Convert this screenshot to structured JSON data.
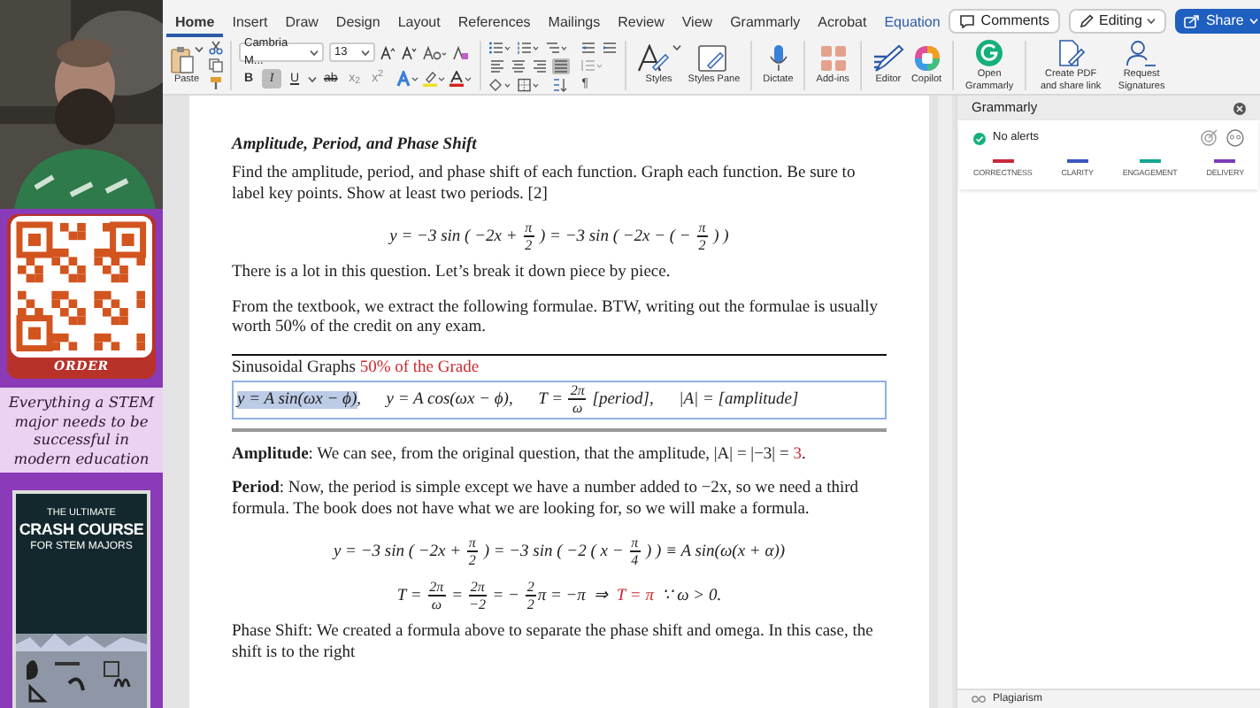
{
  "promo": {
    "button": "ORDER",
    "tagline": "Everything a STEM major needs to be successful in modern education",
    "book": {
      "overline": "THE ULTIMATE",
      "title": "CRASH COURSE",
      "subtitle": "FOR STEM MAJORS"
    }
  },
  "tabs": [
    {
      "label": "Home",
      "selected": true,
      "contextual": false
    },
    {
      "label": "Insert",
      "selected": false,
      "contextual": false
    },
    {
      "label": "Draw",
      "selected": false,
      "contextual": false
    },
    {
      "label": "Design",
      "selected": false,
      "contextual": false
    },
    {
      "label": "Layout",
      "selected": false,
      "contextual": false
    },
    {
      "label": "References",
      "selected": false,
      "contextual": false
    },
    {
      "label": "Mailings",
      "selected": false,
      "contextual": false
    },
    {
      "label": "Review",
      "selected": false,
      "contextual": false
    },
    {
      "label": "View",
      "selected": false,
      "contextual": false
    },
    {
      "label": "Grammarly",
      "selected": false,
      "contextual": false
    },
    {
      "label": "Acrobat",
      "selected": false,
      "contextual": false
    },
    {
      "label": "Equation",
      "selected": false,
      "contextual": true
    }
  ],
  "header_buttons": [
    {
      "kind": "comments",
      "label": "Comments"
    },
    {
      "kind": "editing",
      "label": "Editing"
    },
    {
      "kind": "share",
      "label": "Share"
    }
  ],
  "ribbon": {
    "paste": "Paste",
    "font_name": "Cambria M...",
    "font_size": "13",
    "toggles": [
      {
        "kind": "bold",
        "label": "B",
        "selected": false
      },
      {
        "kind": "italic",
        "label": "I",
        "selected": true
      },
      {
        "kind": "underline",
        "label": "U",
        "selected": false
      },
      {
        "kind": "strike",
        "label": "ab",
        "selected": false
      },
      {
        "kind": "subscript",
        "label": "x$_{2}$",
        "selected": false
      },
      {
        "kind": "superscript",
        "label": "x$^{2}$",
        "selected": false
      }
    ],
    "alignment": [
      {
        "kind": "left",
        "selected": false
      },
      {
        "kind": "center",
        "selected": false
      },
      {
        "kind": "right",
        "selected": false
      },
      {
        "kind": "justify",
        "selected": true
      }
    ],
    "pilcrow": "¶",
    "commands": [
      {
        "kind": "styles",
        "label": "Styles"
      },
      {
        "kind": "styles_pane",
        "label": "Styles Pane"
      },
      {
        "kind": "dictate",
        "label": "Dictate"
      },
      {
        "kind": "addins",
        "label": "Add-ins"
      },
      {
        "kind": "editor",
        "label": "Editor"
      },
      {
        "kind": "copilot",
        "label": "Copilot"
      },
      {
        "kind": "grammarly",
        "label": "Open Grammarly"
      },
      {
        "kind": "pdf",
        "label": "Create PDF and share link"
      },
      {
        "kind": "signatures",
        "label": "Request Signatures"
      }
    ]
  },
  "document": [
    {
      "kind": "heading",
      "segments": [
        {
          "text": "Amplitude, Period, and Phase Shift"
        }
      ]
    },
    {
      "kind": "paragraph",
      "segments": [
        {
          "text": "Find the amplitude, period, and phase shift of each function. Graph each function. Be sure to label key points. Show at least two periods. [2]"
        }
      ]
    },
    {
      "kind": "equation",
      "segments": [
        {
          "text": "y = −3 sin ( −2x + "
        },
        {
          "num": "π",
          "den": "2"
        },
        {
          "text": " ) = −3 sin ( −2x − ( − "
        },
        {
          "num": "π",
          "den": "2"
        },
        {
          "text": " ) )"
        }
      ]
    },
    {
      "kind": "paragraph",
      "segments": [
        {
          "text": "There is a lot in this question. Let’s break it down piece by piece."
        }
      ]
    },
    {
      "kind": "paragraph",
      "segments": [
        {
          "text": "From the textbook, we extract the following formulae. BTW, writing out the formulae is usually worth 50% of the credit on any exam."
        }
      ]
    },
    {
      "kind": "formula_table",
      "segments": [
        {
          "text": "Sinusoidal Graphs "
        },
        {
          "text": "50% of the Grade",
          "accent": true
        }
      ],
      "formula": [
        {
          "text": "y = A sin(ωx − ϕ)",
          "selected": true
        },
        {
          "text": ",      y = A cos(ωx − ϕ),      T = ",
          "selected": false
        },
        {
          "num": "2π",
          "den": "ω",
          "selected": false
        },
        {
          "text": " [period],      |A| = [amplitude]",
          "selected": false
        }
      ]
    },
    {
      "kind": "paragraph",
      "segments": [
        {
          "text": "**Amplitude**: We can see, from the original question, that the amplitude, |A| = |−3| = ",
          "accent": false
        },
        {
          "text": "3",
          "accent": true
        },
        {
          "text": ".",
          "accent": false
        }
      ]
    },
    {
      "kind": "paragraph",
      "segments": [
        {
          "text": "**Period**: Now, the period is simple except we have a number added to −2x, so we need a third formula. The book does not have what we are looking for, so we will make a formula."
        }
      ]
    },
    {
      "kind": "equation",
      "segments": [
        {
          "text": "y = −3 sin ( −2x + "
        },
        {
          "num": "π",
          "den": "2"
        },
        {
          "text": " ) = −3 sin ( −2 ( x − "
        },
        {
          "num": "π",
          "den": "4"
        },
        {
          "text": " ) ) ≡ A sin(ω(x + α))"
        }
      ]
    },
    {
      "kind": "equation",
      "segments": [
        {
          "text": "T = ",
          "accent": false
        },
        {
          "num": "2π",
          "den": "ω"
        },
        {
          "text": " = ",
          "accent": false
        },
        {
          "num": "2π",
          "den": "−2"
        },
        {
          "text": " = − ",
          "accent": false
        },
        {
          "num": "2",
          "den": "2"
        },
        {
          "text": "π = −π  ⇒  ",
          "accent": false
        },
        {
          "text": "T = π",
          "accent": true
        },
        {
          "text": "  ∵ ω > 0.",
          "accent": false
        }
      ]
    },
    {
      "kind": "paragraph",
      "segments": [
        {
          "text": "Phase Shift: We created a formula above to separate the phase shift and omega. In this case, the shift is to the right"
        }
      ]
    }
  ],
  "grammarly": {
    "title": "Grammarly",
    "status": "No alerts",
    "categories": [
      {
        "label": "CORRECTNESS",
        "color": "#c8283c"
      },
      {
        "label": "CLARITY",
        "color": "#3b55c0"
      },
      {
        "label": "ENGAGEMENT",
        "color": "#13a58f"
      },
      {
        "label": "DELIVERY",
        "color": "#7a3cb8"
      }
    ],
    "footer": "Plagiarism"
  }
}
